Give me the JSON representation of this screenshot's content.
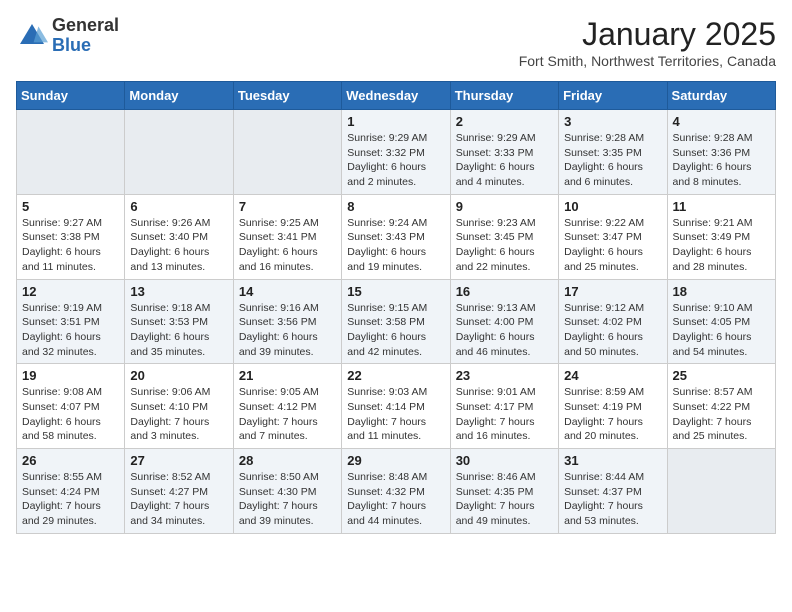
{
  "logo": {
    "general": "General",
    "blue": "Blue"
  },
  "header": {
    "month": "January 2025",
    "location": "Fort Smith, Northwest Territories, Canada"
  },
  "weekdays": [
    "Sunday",
    "Monday",
    "Tuesday",
    "Wednesday",
    "Thursday",
    "Friday",
    "Saturday"
  ],
  "weeks": [
    [
      {
        "day": "",
        "info": ""
      },
      {
        "day": "",
        "info": ""
      },
      {
        "day": "",
        "info": ""
      },
      {
        "day": "1",
        "info": "Sunrise: 9:29 AM\nSunset: 3:32 PM\nDaylight: 6 hours and 2 minutes."
      },
      {
        "day": "2",
        "info": "Sunrise: 9:29 AM\nSunset: 3:33 PM\nDaylight: 6 hours and 4 minutes."
      },
      {
        "day": "3",
        "info": "Sunrise: 9:28 AM\nSunset: 3:35 PM\nDaylight: 6 hours and 6 minutes."
      },
      {
        "day": "4",
        "info": "Sunrise: 9:28 AM\nSunset: 3:36 PM\nDaylight: 6 hours and 8 minutes."
      }
    ],
    [
      {
        "day": "5",
        "info": "Sunrise: 9:27 AM\nSunset: 3:38 PM\nDaylight: 6 hours and 11 minutes."
      },
      {
        "day": "6",
        "info": "Sunrise: 9:26 AM\nSunset: 3:40 PM\nDaylight: 6 hours and 13 minutes."
      },
      {
        "day": "7",
        "info": "Sunrise: 9:25 AM\nSunset: 3:41 PM\nDaylight: 6 hours and 16 minutes."
      },
      {
        "day": "8",
        "info": "Sunrise: 9:24 AM\nSunset: 3:43 PM\nDaylight: 6 hours and 19 minutes."
      },
      {
        "day": "9",
        "info": "Sunrise: 9:23 AM\nSunset: 3:45 PM\nDaylight: 6 hours and 22 minutes."
      },
      {
        "day": "10",
        "info": "Sunrise: 9:22 AM\nSunset: 3:47 PM\nDaylight: 6 hours and 25 minutes."
      },
      {
        "day": "11",
        "info": "Sunrise: 9:21 AM\nSunset: 3:49 PM\nDaylight: 6 hours and 28 minutes."
      }
    ],
    [
      {
        "day": "12",
        "info": "Sunrise: 9:19 AM\nSunset: 3:51 PM\nDaylight: 6 hours and 32 minutes."
      },
      {
        "day": "13",
        "info": "Sunrise: 9:18 AM\nSunset: 3:53 PM\nDaylight: 6 hours and 35 minutes."
      },
      {
        "day": "14",
        "info": "Sunrise: 9:16 AM\nSunset: 3:56 PM\nDaylight: 6 hours and 39 minutes."
      },
      {
        "day": "15",
        "info": "Sunrise: 9:15 AM\nSunset: 3:58 PM\nDaylight: 6 hours and 42 minutes."
      },
      {
        "day": "16",
        "info": "Sunrise: 9:13 AM\nSunset: 4:00 PM\nDaylight: 6 hours and 46 minutes."
      },
      {
        "day": "17",
        "info": "Sunrise: 9:12 AM\nSunset: 4:02 PM\nDaylight: 6 hours and 50 minutes."
      },
      {
        "day": "18",
        "info": "Sunrise: 9:10 AM\nSunset: 4:05 PM\nDaylight: 6 hours and 54 minutes."
      }
    ],
    [
      {
        "day": "19",
        "info": "Sunrise: 9:08 AM\nSunset: 4:07 PM\nDaylight: 6 hours and 58 minutes."
      },
      {
        "day": "20",
        "info": "Sunrise: 9:06 AM\nSunset: 4:10 PM\nDaylight: 7 hours and 3 minutes."
      },
      {
        "day": "21",
        "info": "Sunrise: 9:05 AM\nSunset: 4:12 PM\nDaylight: 7 hours and 7 minutes."
      },
      {
        "day": "22",
        "info": "Sunrise: 9:03 AM\nSunset: 4:14 PM\nDaylight: 7 hours and 11 minutes."
      },
      {
        "day": "23",
        "info": "Sunrise: 9:01 AM\nSunset: 4:17 PM\nDaylight: 7 hours and 16 minutes."
      },
      {
        "day": "24",
        "info": "Sunrise: 8:59 AM\nSunset: 4:19 PM\nDaylight: 7 hours and 20 minutes."
      },
      {
        "day": "25",
        "info": "Sunrise: 8:57 AM\nSunset: 4:22 PM\nDaylight: 7 hours and 25 minutes."
      }
    ],
    [
      {
        "day": "26",
        "info": "Sunrise: 8:55 AM\nSunset: 4:24 PM\nDaylight: 7 hours and 29 minutes."
      },
      {
        "day": "27",
        "info": "Sunrise: 8:52 AM\nSunset: 4:27 PM\nDaylight: 7 hours and 34 minutes."
      },
      {
        "day": "28",
        "info": "Sunrise: 8:50 AM\nSunset: 4:30 PM\nDaylight: 7 hours and 39 minutes."
      },
      {
        "day": "29",
        "info": "Sunrise: 8:48 AM\nSunset: 4:32 PM\nDaylight: 7 hours and 44 minutes."
      },
      {
        "day": "30",
        "info": "Sunrise: 8:46 AM\nSunset: 4:35 PM\nDaylight: 7 hours and 49 minutes."
      },
      {
        "day": "31",
        "info": "Sunrise: 8:44 AM\nSunset: 4:37 PM\nDaylight: 7 hours and 53 minutes."
      },
      {
        "day": "",
        "info": ""
      }
    ]
  ]
}
